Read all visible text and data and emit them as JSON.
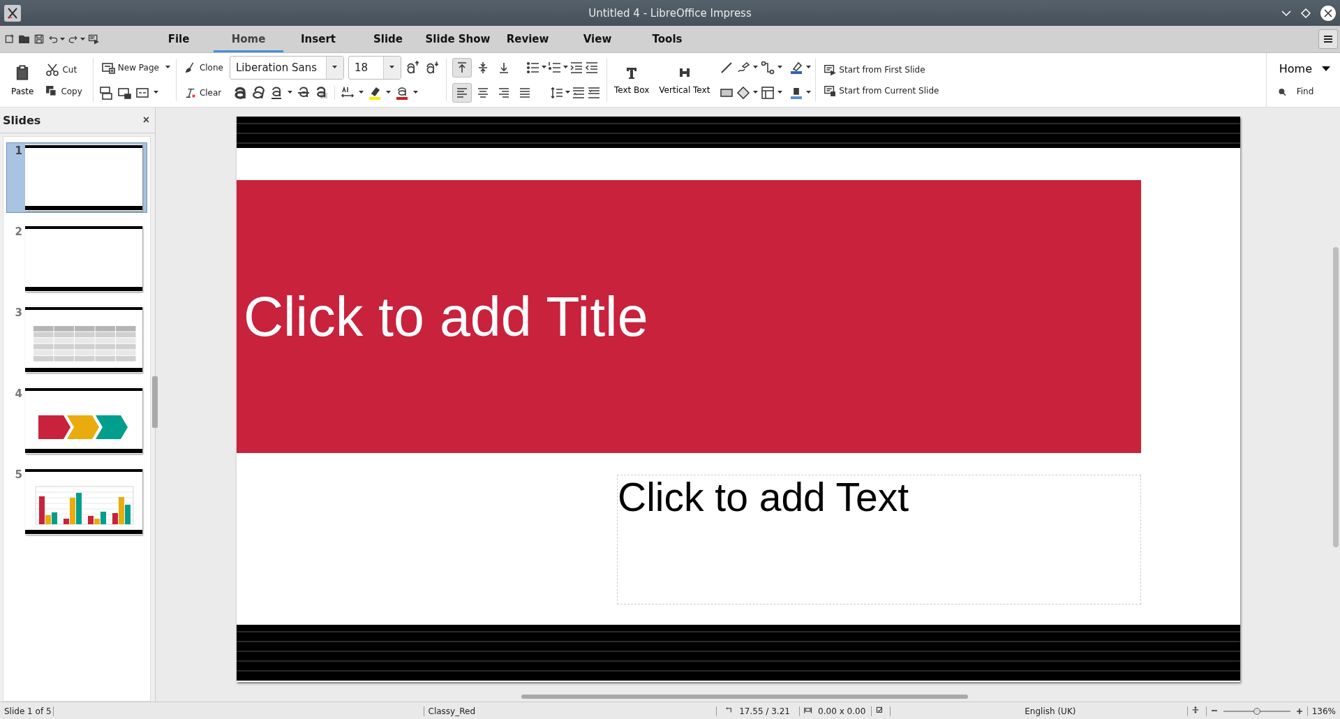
{
  "window": {
    "title": "Untitled 4 - LibreOffice Impress"
  },
  "tabs": [
    {
      "label": "File",
      "selected": false
    },
    {
      "label": "Home",
      "selected": true
    },
    {
      "label": "Insert",
      "selected": false
    },
    {
      "label": "Slide",
      "selected": false
    },
    {
      "label": "Slide Show",
      "selected": false
    },
    {
      "label": "Review",
      "selected": false
    },
    {
      "label": "View",
      "selected": false
    },
    {
      "label": "Tools",
      "selected": false
    }
  ],
  "toolbar": {
    "paste": "Paste",
    "cut": "Cut",
    "copy": "Copy",
    "new_page": "New Page",
    "clone": "Clone",
    "clear": "Clear",
    "font_name": "Liberation Sans",
    "font_size": "18",
    "vertical_align": [
      {
        "selected": true
      },
      {
        "selected": false
      },
      {
        "selected": false
      }
    ],
    "horizontal_align": [
      {
        "selected": true
      },
      {
        "selected": false
      },
      {
        "selected": false
      },
      {
        "selected": false
      }
    ],
    "text_box": "Text Box",
    "vertical_text": "Vertical Text",
    "start_first": "Start from First Slide",
    "start_current": "Start from Current Slide",
    "context_menu": "Home",
    "find": "Find"
  },
  "slides_panel": {
    "title": "Slides",
    "close": "×",
    "slides": [
      {
        "number": "1",
        "kind": "blank",
        "selected": true
      },
      {
        "number": "2",
        "kind": "blank",
        "selected": false
      },
      {
        "number": "3",
        "kind": "table",
        "selected": false
      },
      {
        "number": "4",
        "kind": "arrows",
        "selected": false
      },
      {
        "number": "5",
        "kind": "chart",
        "selected": false
      }
    ]
  },
  "slide": {
    "title_placeholder": "Click to add Title",
    "text_placeholder": "Click to add Text"
  },
  "status_bar": {
    "slide": "Slide 1 of 5",
    "master": "Classy_Red",
    "position": "17.55 / 3.21",
    "size": "0.00 x 0.00",
    "language": "English (UK)",
    "zoom_slider": {
      "level": 0.5
    },
    "zoom": "136%"
  }
}
